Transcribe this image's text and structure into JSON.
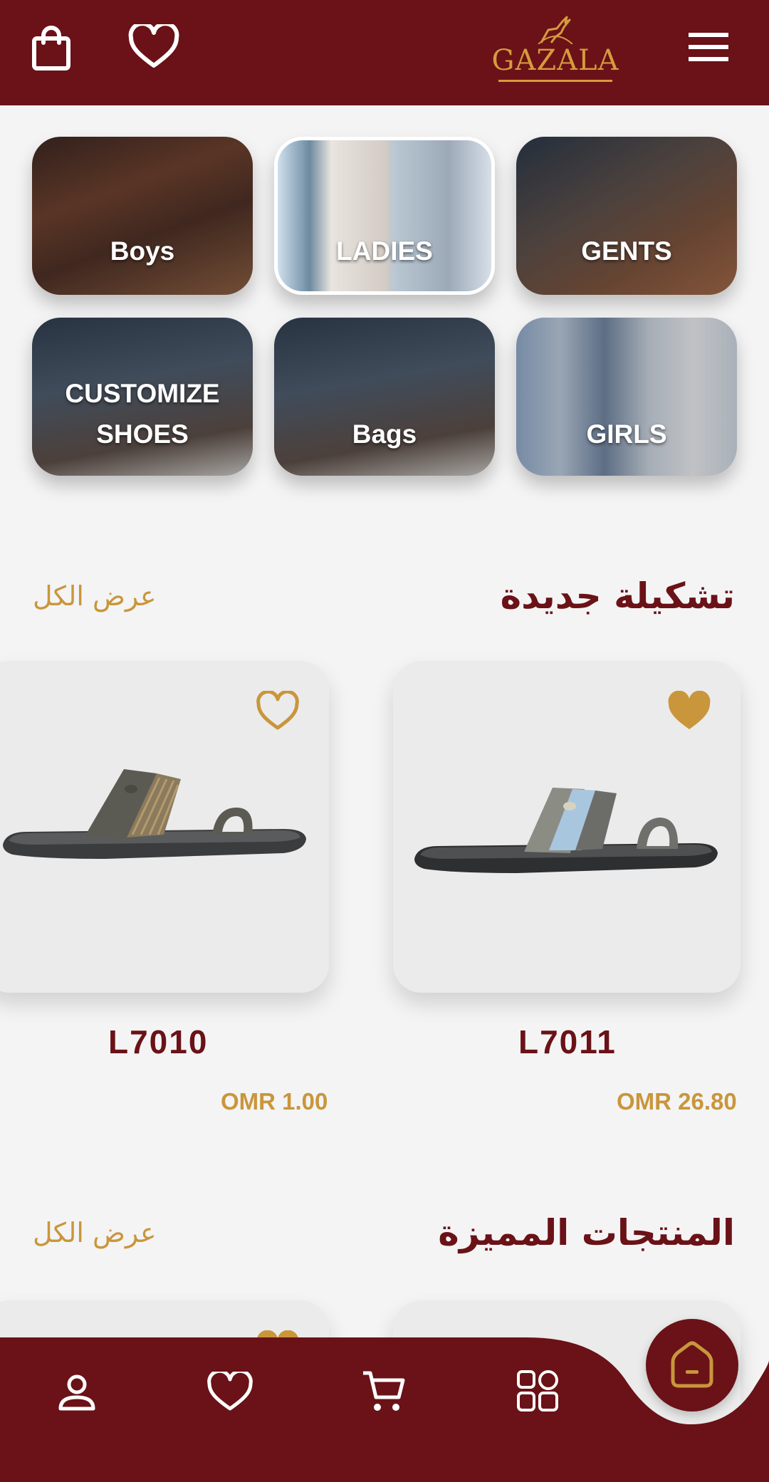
{
  "header": {
    "logo_text": "GAZALA",
    "icons": [
      "shopping-bag-icon",
      "heart-icon",
      "hamburger-menu-icon"
    ]
  },
  "categories": [
    {
      "label": "Boys"
    },
    {
      "label": "LADIES"
    },
    {
      "label": "GENTS"
    },
    {
      "label_line1": "CUSTOMIZE",
      "label_line2": "SHOES"
    },
    {
      "label": "Bags"
    },
    {
      "label": "GIRLS"
    }
  ],
  "new_collection": {
    "title": "تشكيلة جديدة",
    "view_all": "عرض الكل",
    "products": [
      {
        "name": "L7011",
        "price": "OMR 26.80",
        "favorite": true
      },
      {
        "name": "L7010",
        "price": "OMR 1.00",
        "favorite": false
      }
    ]
  },
  "featured": {
    "title": "المنتجات المميزة",
    "view_all": "عرض الكل"
  },
  "bottom_nav": {
    "items": [
      "account-icon",
      "favorites-icon",
      "cart-icon",
      "categories-icon",
      "home-icon"
    ]
  },
  "colors": {
    "brand": "#6a1217",
    "accent": "#c9963c",
    "background": "#f4f4f4"
  }
}
